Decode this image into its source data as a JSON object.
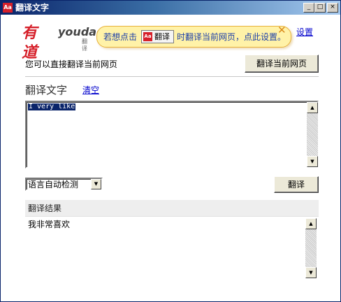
{
  "window": {
    "title": "翻译文字",
    "icon_text": "Aa",
    "controls": {
      "minimize": "_",
      "maximize": "□",
      "close": "×"
    }
  },
  "logo": {
    "cn": "有道",
    "en": "youdao",
    "sub": "翻译"
  },
  "tip": {
    "prefix": "若想点击",
    "button_icon_text": "Aa",
    "button_label": "翻译",
    "suffix": "时翻译当前网页，点此设置。",
    "close_glyph": "✕"
  },
  "settings_link": "设置",
  "page_section": {
    "description": "您可以直接翻译当前网页",
    "translate_page_button": "翻译当前网页"
  },
  "text_section": {
    "title": "翻译文字",
    "clear_link": "清空",
    "input_value": "I very like"
  },
  "language_select": {
    "selected": "语言自动检测"
  },
  "translate_button": "翻译",
  "result": {
    "header": "翻译结果",
    "text": "我非常喜欢"
  },
  "scroll": {
    "up": "▲",
    "down": "▼"
  },
  "colors": {
    "accent_red": "#d6202a",
    "link_blue": "#0000cc",
    "tip_bg": "#fff2a8",
    "selection": "#0a246a"
  }
}
